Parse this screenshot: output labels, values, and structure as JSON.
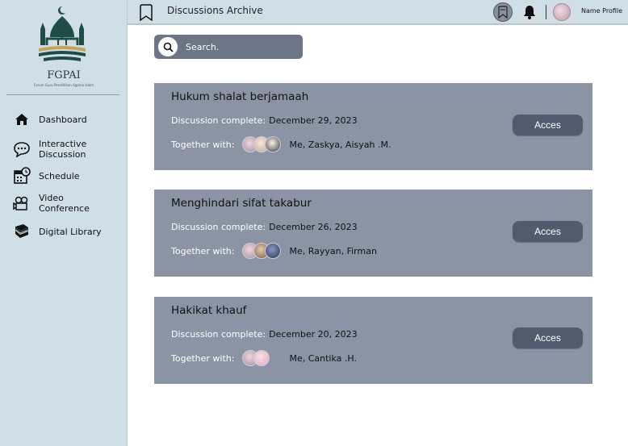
{
  "sidebar": {
    "brand": "FGPAI",
    "tagline": "Forum Guru Pendidikan Agama Islam",
    "items": [
      {
        "label": "Dashboard",
        "icon": "home-icon"
      },
      {
        "label": "Interactive\nDiscussion",
        "icon": "chat-icon"
      },
      {
        "label": "Schedule",
        "icon": "calendar-clock-icon"
      },
      {
        "label": "Video\nConference",
        "icon": "video-camera-icon"
      },
      {
        "label": "Digital Library",
        "icon": "books-icon"
      }
    ]
  },
  "header": {
    "title": "Discussions Archive",
    "profile_name": "Name Profile"
  },
  "search": {
    "placeholder": "Search."
  },
  "discussions": [
    {
      "title": "Hukum shalat berjamaah",
      "complete_label": "Discussion complete:",
      "date": "December 29, 2023",
      "together_label": "Together with:",
      "participants": "Me, Zaskya, Aisyah .M.",
      "button": "Acces"
    },
    {
      "title": "Menghindari sifat takabur",
      "complete_label": "Discussion complete:",
      "date": "December 26, 2023",
      "together_label": "Together with:",
      "participants": "Me, Rayyan, Firman",
      "button": "Acces"
    },
    {
      "title": "Hakikat khauf",
      "complete_label": "Discussion complete:",
      "date": "December 20, 2023",
      "together_label": "Together with:",
      "participants": "Me, Cantika .H.",
      "button": "Acces"
    }
  ],
  "colors": {
    "sidebar": "#d0dfe6",
    "card": "#8a94a5",
    "button": "#525b6d",
    "search": "#6b7585",
    "brand": "#1e4d45"
  }
}
